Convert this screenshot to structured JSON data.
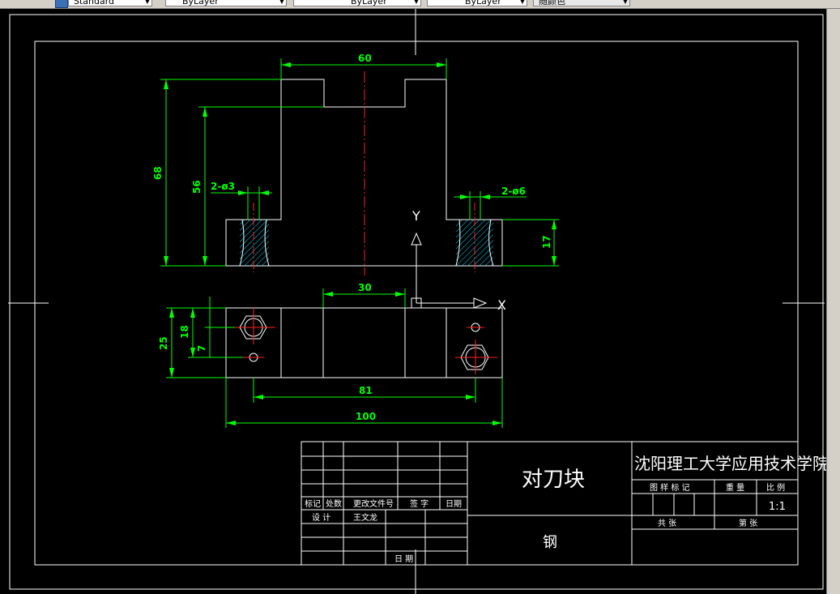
{
  "toolbar": {
    "textstyle": "Standard",
    "layer": "ByLayer",
    "linetype": "ByLayer",
    "lineweight": "ByLayer",
    "plotstyle": "随颜色"
  },
  "dimensions": {
    "width_top": "60",
    "height_total": "68",
    "height_inner": "56",
    "hole_left": "2-ø3",
    "hole_right": "2-ø6",
    "base_height": "17",
    "slot_width": "30",
    "depth": "25",
    "offset1": "18",
    "offset2": "7",
    "hole_spacing": "81",
    "length": "100"
  },
  "axes": {
    "x": "X",
    "y": "Y"
  },
  "title_block": {
    "school": "沈阳理工大学应用技术学院",
    "part_name": "对刀块",
    "material": "钢",
    "col_mark": "标记",
    "col_count": "处数",
    "col_change_doc": "更改文件号",
    "col_sign": "签 字",
    "col_date": "日期",
    "design_label": "设 计",
    "designer": "王文龙",
    "date_label": "日 期",
    "stage_label": "图 样 标 记",
    "weight_label": "重 量",
    "scale_label": "比 例",
    "scale_value": "1:1",
    "total_sheets": "共     张",
    "sheet_no": "第     张"
  }
}
